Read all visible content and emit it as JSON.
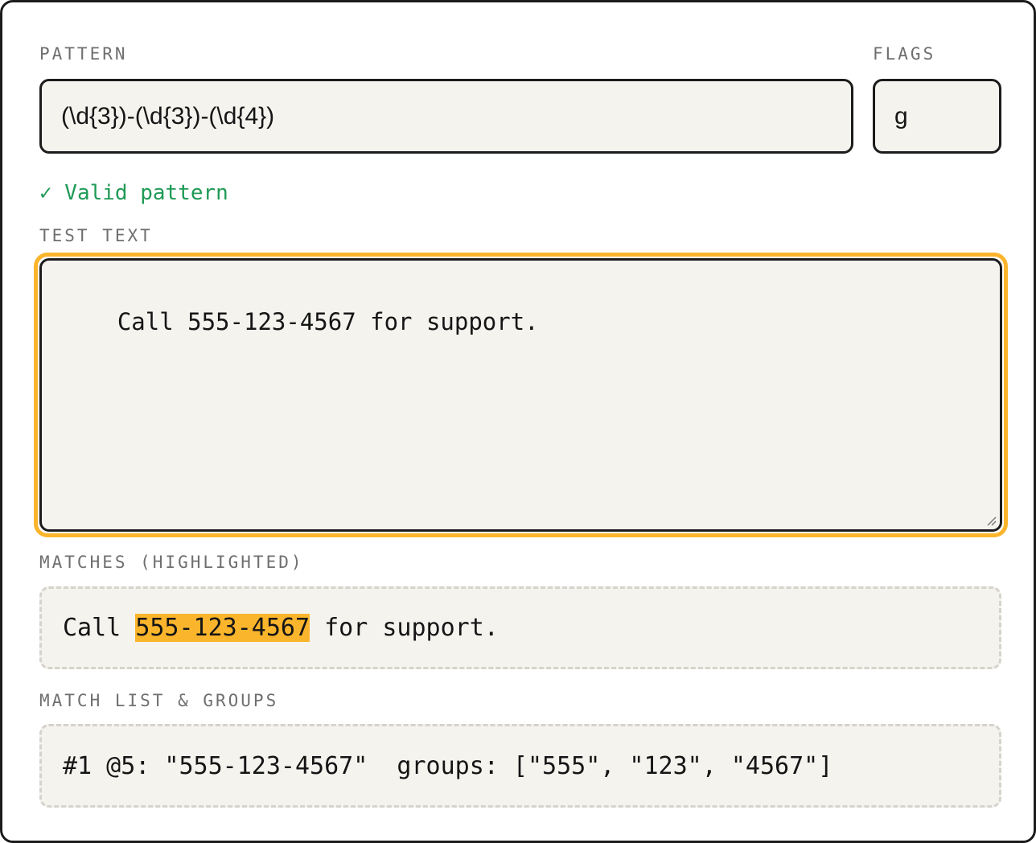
{
  "pattern": {
    "label": "PATTERN",
    "value": "(\\d{3})-(\\d{3})-(\\d{4})"
  },
  "flags": {
    "label": "FLAGS",
    "value": "g"
  },
  "status": {
    "text": "✓ Valid pattern",
    "color": "#1f9a56"
  },
  "test_text": {
    "label": "TEST TEXT",
    "value": "Call 555-123-4567 for support."
  },
  "matches": {
    "label": "MATCHES (HIGHLIGHTED)",
    "before": "Call ",
    "highlight": "555-123-4567",
    "after": " for support.",
    "highlight_color": "#fbb52c"
  },
  "match_list": {
    "label": "MATCH LIST & GROUPS",
    "items": [
      "#1 @5: \"555-123-4567\"  groups: [\"555\", \"123\", \"4567\"]"
    ]
  },
  "colors": {
    "focus_ring": "#fbb52c",
    "field_bg": "#f4f3ee",
    "border": "#1c1c1c"
  },
  "icons": {
    "resize": "resize-grip-icon"
  }
}
